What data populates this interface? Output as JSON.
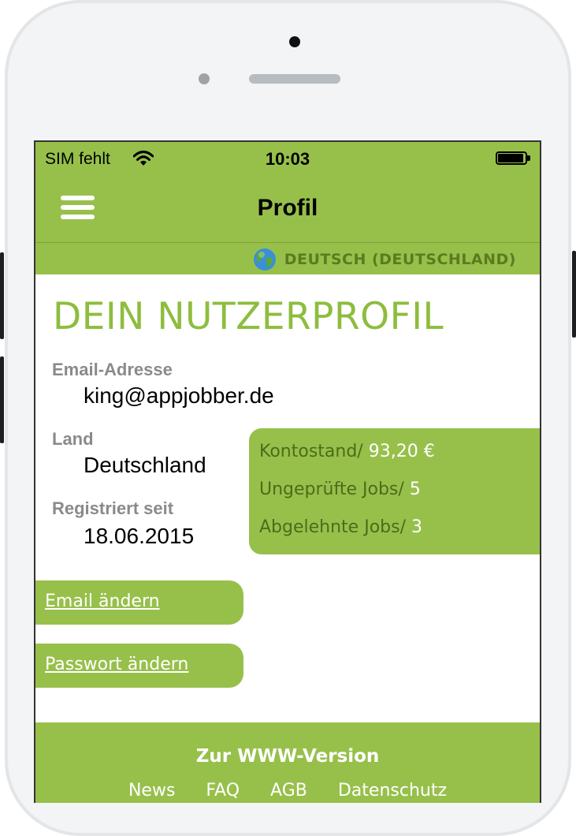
{
  "status_bar": {
    "carrier": "SIM fehlt",
    "time": "10:03",
    "wifi_icon": "wifi-icon",
    "battery_icon": "battery-icon"
  },
  "navbar": {
    "title": "Profil",
    "menu_icon": "hamburger-menu-icon"
  },
  "language": {
    "label": "DEUTSCH (DEUTSCHLAND)",
    "icon": "globe-icon"
  },
  "profile": {
    "heading": "DEIN NUTZERPROFIL",
    "email_label": "Email-Adresse",
    "email_value": "king@appjobber.de",
    "country_label": "Land",
    "country_value": "Deutschland",
    "registered_label": "Registriert seit",
    "registered_value": "18.06.2015"
  },
  "stats": {
    "balance_label": "Kontostand/",
    "balance_value": "93,20 €",
    "unchecked_label": "Ungeprüfte Jobs/",
    "unchecked_value": "5",
    "rejected_label": "Abgelehnte Jobs/",
    "rejected_value": "3"
  },
  "actions": {
    "change_email": "Email ändern",
    "change_password": "Passwort ändern"
  },
  "footer": {
    "www_link": "Zur WWW-Version",
    "links": [
      "News",
      "FAQ",
      "AGB",
      "Datenschutz"
    ]
  },
  "colors": {
    "brand_green": "#97c04b",
    "heading_green": "#8dbd3e",
    "label_gray": "#8a8a8a"
  }
}
